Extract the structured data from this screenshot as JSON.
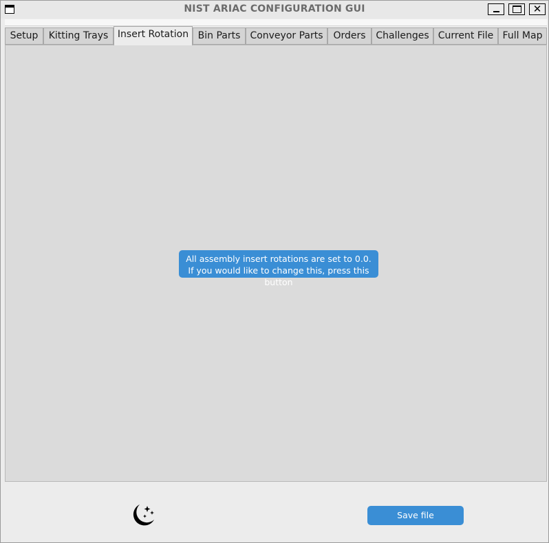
{
  "window": {
    "title": "NIST ARIAC CONFIGURATION GUI"
  },
  "tabs": [
    {
      "label": "Setup",
      "active": false
    },
    {
      "label": "Kitting Trays",
      "active": false
    },
    {
      "label": "Insert Rotation",
      "active": true
    },
    {
      "label": "Bin Parts",
      "active": false
    },
    {
      "label": "Conveyor Parts",
      "active": false
    },
    {
      "label": "Orders",
      "active": false
    },
    {
      "label": "Challenges",
      "active": false
    },
    {
      "label": "Current File",
      "active": false
    },
    {
      "label": "Full Map",
      "active": false
    }
  ],
  "insert_rotation": {
    "message_line1": "All assembly insert rotations are set to 0.0.",
    "message_line2": "If you would like to change this, press this button"
  },
  "footer": {
    "theme_icon": "moon-stars-icon",
    "save_label": "Save file"
  },
  "colors": {
    "accent": "#3a8ed5",
    "content_bg": "#dbdbdb",
    "window_bg": "#ececec"
  }
}
